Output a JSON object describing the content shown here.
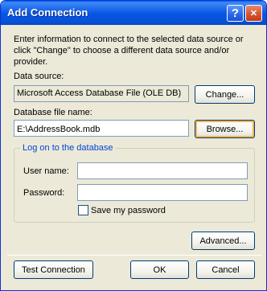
{
  "window": {
    "title": "Add Connection",
    "help_glyph": "?",
    "close_glyph": "✕"
  },
  "intro_text": "Enter information to connect to the selected data source or click \"Change\" to choose a different data source and/or provider.",
  "data_source": {
    "label": "Data source:",
    "value": "Microsoft Access Database File (OLE DB)",
    "change_button": "Change..."
  },
  "database_file": {
    "label": "Database file name:",
    "value": "E:\\AddressBook.mdb",
    "browse_button": "Browse..."
  },
  "logon": {
    "group_title": "Log on to the database",
    "user_name_label": "User name:",
    "user_name_value": "",
    "password_label": "Password:",
    "password_value": "",
    "save_password_label": "Save my password",
    "save_password_checked": false
  },
  "buttons": {
    "advanced": "Advanced...",
    "test_connection": "Test Connection",
    "ok": "OK",
    "cancel": "Cancel"
  },
  "colors": {
    "title_bar": "#0655E4",
    "dialog_background": "#ECE9D8",
    "group_title": "#0046D5",
    "close_button": "#D2502E"
  }
}
